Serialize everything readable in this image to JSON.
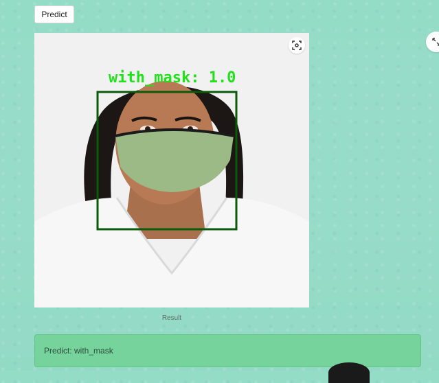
{
  "toolbar": {
    "predict_label": "Predict"
  },
  "image": {
    "detection_label": "with_mask: 1.0",
    "box_color": "#0a5a0a",
    "label_color": "#22e11b"
  },
  "caption": "Result",
  "result": {
    "text": "Predict: with_mask"
  },
  "colors": {
    "background": "#95dcc7",
    "result_bg": "#76d39b"
  }
}
